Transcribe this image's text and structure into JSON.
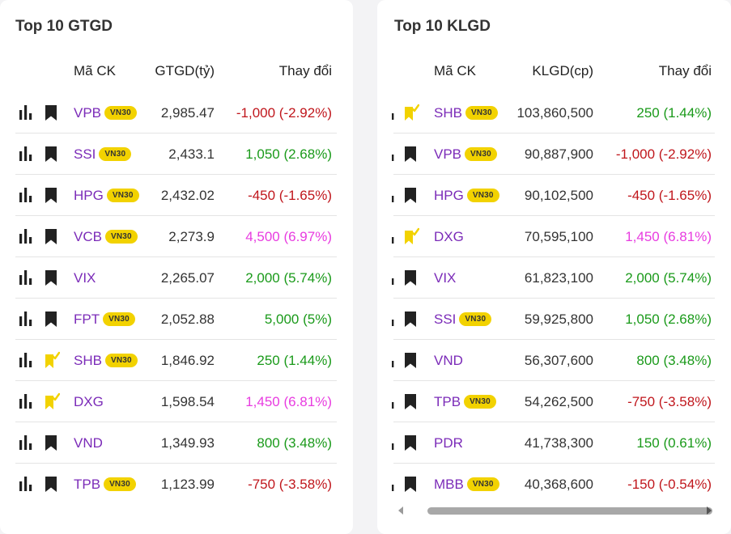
{
  "left": {
    "title": "Top 10 GTGD",
    "headers": {
      "symbol": "Mã CK",
      "value": "GTGD(tỷ)",
      "change": "Thay đổi"
    },
    "rows": [
      {
        "symbol": "VPB",
        "badge": "VN30",
        "value": "2,985.47",
        "change": "-1,000 (-2.92%)",
        "trend": "down",
        "watch": "bookmark"
      },
      {
        "symbol": "SSI",
        "badge": "VN30",
        "value": "2,433.1",
        "change": "1,050 (2.68%)",
        "trend": "up",
        "watch": "bookmark"
      },
      {
        "symbol": "HPG",
        "badge": "VN30",
        "value": "2,432.02",
        "change": "-450 (-1.65%)",
        "trend": "down",
        "watch": "bookmark"
      },
      {
        "symbol": "VCB",
        "badge": "VN30",
        "value": "2,273.9",
        "change": "4,500 (6.97%)",
        "trend": "ceil",
        "watch": "bookmark"
      },
      {
        "symbol": "VIX",
        "badge": "",
        "value": "2,265.07",
        "change": "2,000 (5.74%)",
        "trend": "up",
        "watch": "bookmark"
      },
      {
        "symbol": "FPT",
        "badge": "VN30",
        "value": "2,052.88",
        "change": "5,000 (5%)",
        "trend": "up",
        "watch": "bookmark"
      },
      {
        "symbol": "SHB",
        "badge": "VN30",
        "value": "1,846.92",
        "change": "250 (1.44%)",
        "trend": "up",
        "watch": "flag"
      },
      {
        "symbol": "DXG",
        "badge": "",
        "value": "1,598.54",
        "change": "1,450 (6.81%)",
        "trend": "ceil",
        "watch": "flag"
      },
      {
        "symbol": "VND",
        "badge": "",
        "value": "1,349.93",
        "change": "800 (3.48%)",
        "trend": "up",
        "watch": "bookmark"
      },
      {
        "symbol": "TPB",
        "badge": "VN30",
        "value": "1,123.99",
        "change": "-750 (-3.58%)",
        "trend": "down",
        "watch": "bookmark"
      }
    ]
  },
  "right": {
    "title": "Top 10 KLGD",
    "headers": {
      "symbol": "Mã CK",
      "value": "KLGD(cp)",
      "change": "Thay đổi"
    },
    "rows": [
      {
        "symbol": "SHB",
        "badge": "VN30",
        "value": "103,860,500",
        "change": "250 (1.44%)",
        "trend": "up",
        "watch": "flag"
      },
      {
        "symbol": "VPB",
        "badge": "VN30",
        "value": "90,887,900",
        "change": "-1,000 (-2.92%)",
        "trend": "down",
        "watch": "bookmark"
      },
      {
        "symbol": "HPG",
        "badge": "VN30",
        "value": "90,102,500",
        "change": "-450 (-1.65%)",
        "trend": "down",
        "watch": "bookmark"
      },
      {
        "symbol": "DXG",
        "badge": "",
        "value": "70,595,100",
        "change": "1,450 (6.81%)",
        "trend": "ceil",
        "watch": "flag"
      },
      {
        "symbol": "VIX",
        "badge": "",
        "value": "61,823,100",
        "change": "2,000 (5.74%)",
        "trend": "up",
        "watch": "bookmark"
      },
      {
        "symbol": "SSI",
        "badge": "VN30",
        "value": "59,925,800",
        "change": "1,050 (2.68%)",
        "trend": "up",
        "watch": "bookmark"
      },
      {
        "symbol": "VND",
        "badge": "",
        "value": "56,307,600",
        "change": "800 (3.48%)",
        "trend": "up",
        "watch": "bookmark"
      },
      {
        "symbol": "TPB",
        "badge": "VN30",
        "value": "54,262,500",
        "change": "-750 (-3.58%)",
        "trend": "down",
        "watch": "bookmark"
      },
      {
        "symbol": "PDR",
        "badge": "",
        "value": "41,738,300",
        "change": "150 (0.61%)",
        "trend": "up",
        "watch": "bookmark"
      },
      {
        "symbol": "MBB",
        "badge": "VN30",
        "value": "40,368,600",
        "change": "-150 (-0.54%)",
        "trend": "down",
        "watch": "bookmark"
      }
    ]
  },
  "colors": {
    "up": "#1a9a1a",
    "down": "#c0161c",
    "ceil": "#e83ce0",
    "symbol": "#7b2bb8",
    "badge": "#f2d200",
    "flag": "#f2d200",
    "icon": "#222222"
  },
  "icons": {
    "chart": "bar-chart-icon",
    "bookmark": "bookmark-icon",
    "flag": "flag-check-icon"
  }
}
